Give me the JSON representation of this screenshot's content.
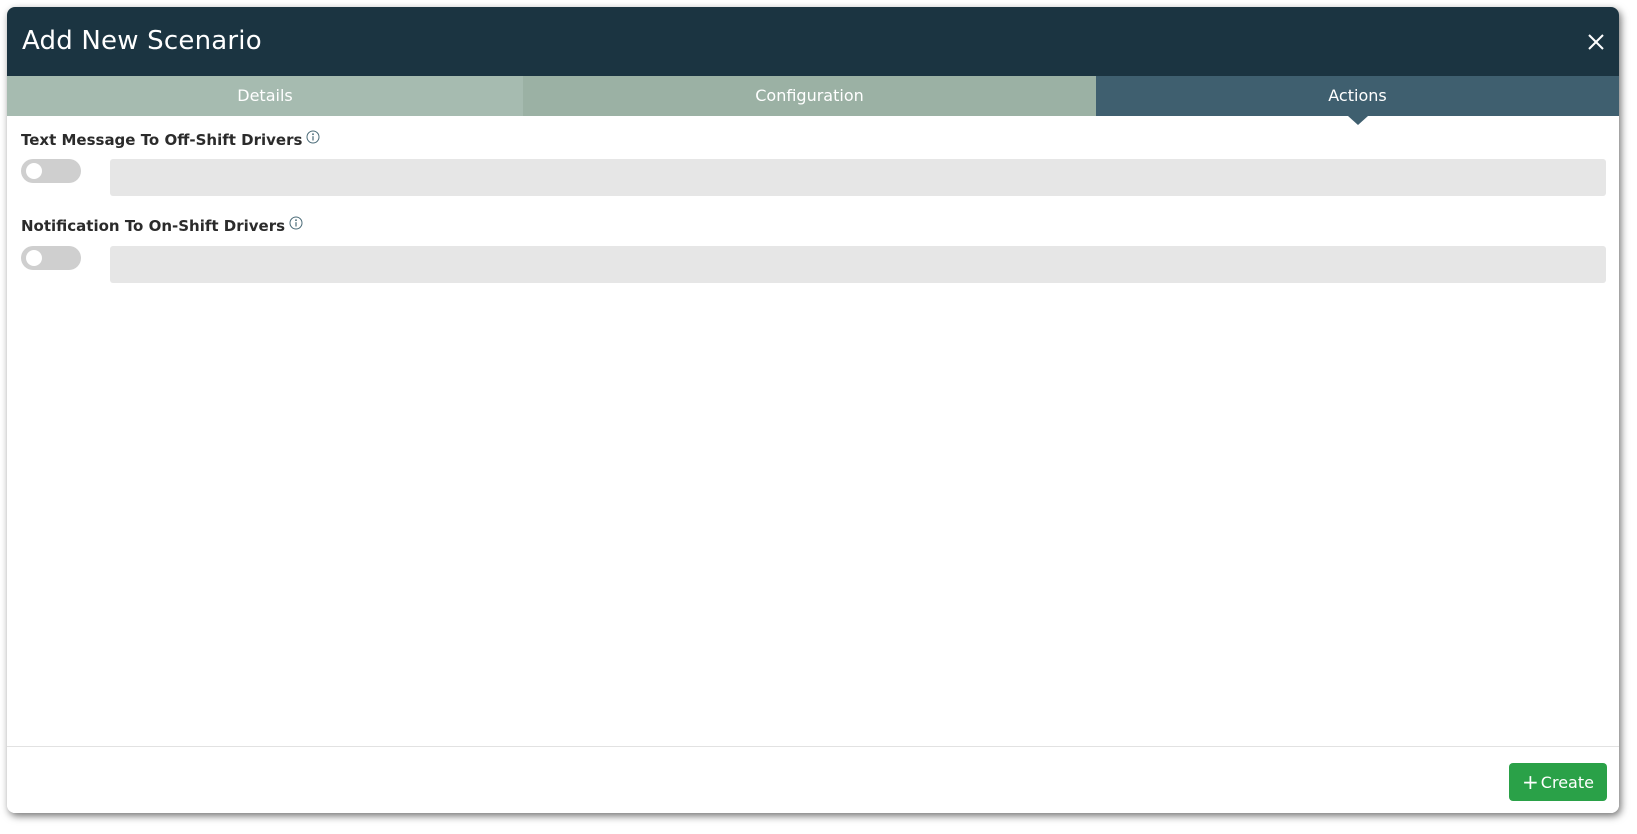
{
  "modal": {
    "title": "Add New Scenario"
  },
  "tabs": [
    {
      "label": "Details",
      "active": false
    },
    {
      "label": "Configuration",
      "active": false
    },
    {
      "label": "Actions",
      "active": true
    }
  ],
  "actions": [
    {
      "label": "Text Message To Off-Shift Drivers",
      "toggle_on": false,
      "value": "",
      "icon": "info-icon"
    },
    {
      "label": "Notification To On-Shift Drivers",
      "toggle_on": false,
      "value": "",
      "icon": "info-icon"
    }
  ],
  "footer": {
    "create_icon": "+",
    "create_label": "Create"
  },
  "colors": {
    "header_bg": "#1b3441",
    "tab_details": "#a6bbb0",
    "tab_configuration": "#9bb1a4",
    "tab_active": "#3f5f6f",
    "toggle_off": "#cfcfcf",
    "field_bg": "#e6e6e6",
    "create_button": "#2aa148"
  },
  "icons": {
    "close": "close-icon",
    "info": "info-icon",
    "plus": "plus-icon"
  }
}
